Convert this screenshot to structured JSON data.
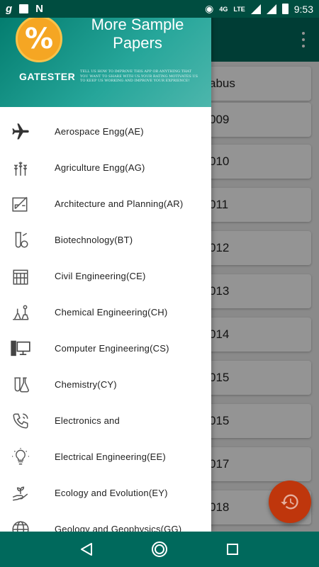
{
  "status_bar": {
    "left_icons": [
      "g-app-icon",
      "image-icon",
      "n-app-icon"
    ],
    "network": "4G",
    "lte": "LTE",
    "time": "9:53"
  },
  "background": {
    "cards": [
      "abus",
      "009",
      "010",
      "011",
      "012",
      "013",
      "014",
      "015",
      "015",
      "017",
      "018"
    ]
  },
  "drawer": {
    "header": {
      "logo_symbol": "%",
      "title": "More Sample Papers",
      "brand": "GATESTER",
      "message": "TELL US HOW TO IMPROVE THIS APP OR ANYTHING THAT YOU WANT TO SHARE WITH US.YOUR RATING MOTIVATES US TO KEEP US WORKING AND IMPROVE YOUR EXPRIENCE!"
    },
    "items": [
      {
        "label": "Aerospace Engg(AE)",
        "icon": "airplane-icon"
      },
      {
        "label": "Agriculture Engg(AG)",
        "icon": "wheat-icon"
      },
      {
        "label": "Architecture and Planning(AR)",
        "icon": "drafting-icon"
      },
      {
        "label": "Biotechnology(BT)",
        "icon": "test-tube-icon"
      },
      {
        "label": "Civil Engineering(CE)",
        "icon": "building-icon"
      },
      {
        "label": "Chemical Engineering(CH)",
        "icon": "lab-equipment-icon"
      },
      {
        "label": "Computer Engineering(CS)",
        "icon": "computer-icon"
      },
      {
        "label": "Chemistry(CY)",
        "icon": "flask-icon"
      },
      {
        "label": "Electronics and",
        "icon": "phone-icon"
      },
      {
        "label": "Electrical Engineering(EE)",
        "icon": "lightbulb-icon"
      },
      {
        "label": "Ecology and Evolution(EY)",
        "icon": "plant-hand-icon"
      },
      {
        "label": "Geology and Geophysics(GG)",
        "icon": "globe-icon"
      }
    ]
  },
  "fab": {
    "icon": "history-icon",
    "color": "#bf360c"
  },
  "colors": {
    "primary": "#00695c",
    "header": "#26a69a",
    "logo": "#f5a623"
  }
}
